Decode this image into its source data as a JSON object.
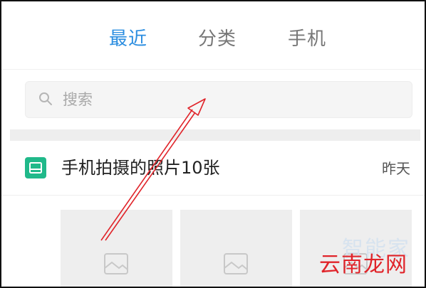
{
  "tabs": [
    {
      "label": "最近",
      "active": true
    },
    {
      "label": "分类",
      "active": false
    },
    {
      "label": "手机",
      "active": false
    }
  ],
  "search": {
    "placeholder": "搜索",
    "icon": "search-icon"
  },
  "album": {
    "title": "手机拍摄的照片10张",
    "date": "昨天",
    "icon": "album-icon"
  },
  "thumbnails": [
    {
      "icon": "image-placeholder-icon"
    },
    {
      "icon": "image-placeholder-icon"
    },
    {
      "icon": "image-placeholder-icon"
    }
  ],
  "watermark": {
    "line1": "智能家",
    "line2": "云南龙网"
  },
  "colors": {
    "accent": "#2a8de0",
    "album_icon": "#20b98a",
    "arrow": "#e0242a"
  }
}
